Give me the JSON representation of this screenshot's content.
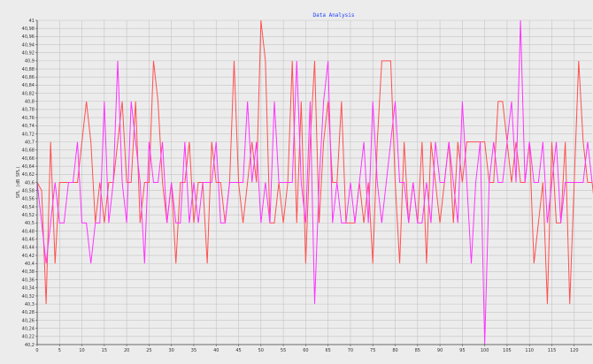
{
  "chart_data": {
    "type": "line",
    "title": "Data Analysis",
    "ylabel": "SPL (dB SPL)",
    "xlabel": "",
    "xlim": [
      0,
      124
    ],
    "ylim": [
      40.2,
      41.0
    ],
    "grid": true,
    "x_ticks": [
      0,
      5,
      10,
      15,
      20,
      25,
      30,
      35,
      40,
      45,
      50,
      55,
      60,
      65,
      70,
      75,
      80,
      85,
      90,
      95,
      100,
      105,
      110,
      115,
      120
    ],
    "y_ticks": [
      "41",
      "40,98",
      "40,96",
      "40,94",
      "40,92",
      "40,9",
      "40,88",
      "40,86",
      "40,84",
      "40,82",
      "40,8",
      "40,78",
      "40,76",
      "40,74",
      "40,72",
      "40,7",
      "40,68",
      "40,66",
      "40,64",
      "40,62",
      "40,6",
      "40,58",
      "40,56",
      "40,54",
      "40,52",
      "40,5",
      "40,48",
      "40,46",
      "40,44",
      "40,42",
      "40,4",
      "40,38",
      "40,36",
      "40,34",
      "40,32",
      "40,3",
      "40,28",
      "40,26",
      "40,24",
      "40,22",
      "40,2"
    ],
    "colors": {
      "series1": "#ff5050",
      "series2": "#ff33ff",
      "background": "#ececec",
      "grid": "#c4c4c4"
    },
    "series": [
      {
        "values": [
          40.6,
          40.58,
          40.3,
          40.7,
          40.4,
          40.6,
          40.6,
          40.6,
          40.6,
          40.6,
          40.7,
          40.8,
          40.7,
          40.5,
          40.6,
          40.5,
          40.6,
          40.6,
          40.7,
          40.8,
          40.6,
          40.6,
          40.8,
          40.5,
          40.6,
          40.6,
          40.9,
          40.8,
          40.6,
          40.5,
          40.6,
          40.4,
          40.6,
          40.6,
          40.7,
          40.5,
          40.6,
          40.6,
          40.4,
          40.7,
          40.6,
          40.6,
          40.5,
          40.6,
          40.9,
          40.6,
          40.5,
          40.6,
          40.7,
          40.6,
          41.0,
          40.9,
          40.5,
          40.5,
          40.6,
          40.5,
          40.6,
          40.9,
          40.5,
          40.8,
          40.4,
          40.7,
          40.9,
          40.5,
          40.7,
          40.8,
          40.6,
          40.6,
          40.8,
          40.5,
          40.5,
          40.5,
          40.6,
          40.5,
          40.6,
          40.4,
          40.7,
          40.9,
          40.9,
          40.9,
          40.6,
          40.4,
          40.7,
          40.5,
          40.6,
          40.5,
          40.7,
          40.4,
          40.7,
          40.6,
          40.5,
          40.6,
          40.7,
          40.5,
          40.7,
          40.6,
          40.7,
          40.7,
          40.7,
          40.7,
          40.7,
          40.6,
          40.6,
          40.8,
          40.8,
          40.7,
          40.6,
          40.7,
          40.6,
          40.6,
          40.7,
          40.4,
          40.5,
          40.6,
          40.3,
          40.7,
          40.5,
          40.5,
          40.7,
          40.3,
          40.6,
          40.9,
          40.7,
          40.6,
          40.6,
          40.5
        ],
        "color": "#ff5050"
      },
      {
        "values": [
          40.6,
          40.5,
          40.4,
          40.5,
          40.6,
          40.5,
          40.5,
          40.6,
          40.6,
          40.7,
          40.5,
          40.5,
          40.4,
          40.5,
          40.5,
          40.8,
          40.5,
          40.6,
          40.9,
          40.6,
          40.5,
          40.8,
          40.7,
          40.6,
          40.4,
          40.7,
          40.6,
          40.6,
          40.7,
          40.5,
          40.6,
          40.5,
          40.5,
          40.7,
          40.5,
          40.6,
          40.5,
          40.6,
          40.6,
          40.6,
          40.7,
          40.5,
          40.5,
          40.6,
          40.6,
          40.6,
          40.6,
          40.8,
          40.6,
          40.7,
          40.5,
          40.6,
          40.5,
          40.8,
          40.6,
          40.6,
          40.6,
          40.6,
          40.9,
          40.6,
          40.5,
          40.8,
          40.3,
          40.6,
          40.8,
          40.9,
          40.5,
          40.6,
          40.5,
          40.5,
          40.6,
          40.5,
          40.6,
          40.7,
          40.5,
          40.8,
          40.6,
          40.5,
          40.6,
          40.7,
          40.8,
          40.6,
          40.6,
          40.5,
          40.6,
          40.5,
          40.5,
          40.6,
          40.5,
          40.7,
          40.6,
          40.6,
          40.7,
          40.6,
          40.5,
          40.8,
          40.6,
          40.4,
          40.6,
          40.7,
          40.2,
          40.6,
          40.7,
          40.6,
          40.6,
          40.7,
          40.8,
          40.6,
          41.0,
          40.6,
          40.7,
          40.6,
          40.6,
          40.7,
          40.5,
          40.6,
          40.7,
          40.5,
          40.6,
          40.6,
          40.6,
          40.6,
          40.6,
          40.7,
          40.6
        ],
        "color": "#ff33ff"
      }
    ]
  }
}
